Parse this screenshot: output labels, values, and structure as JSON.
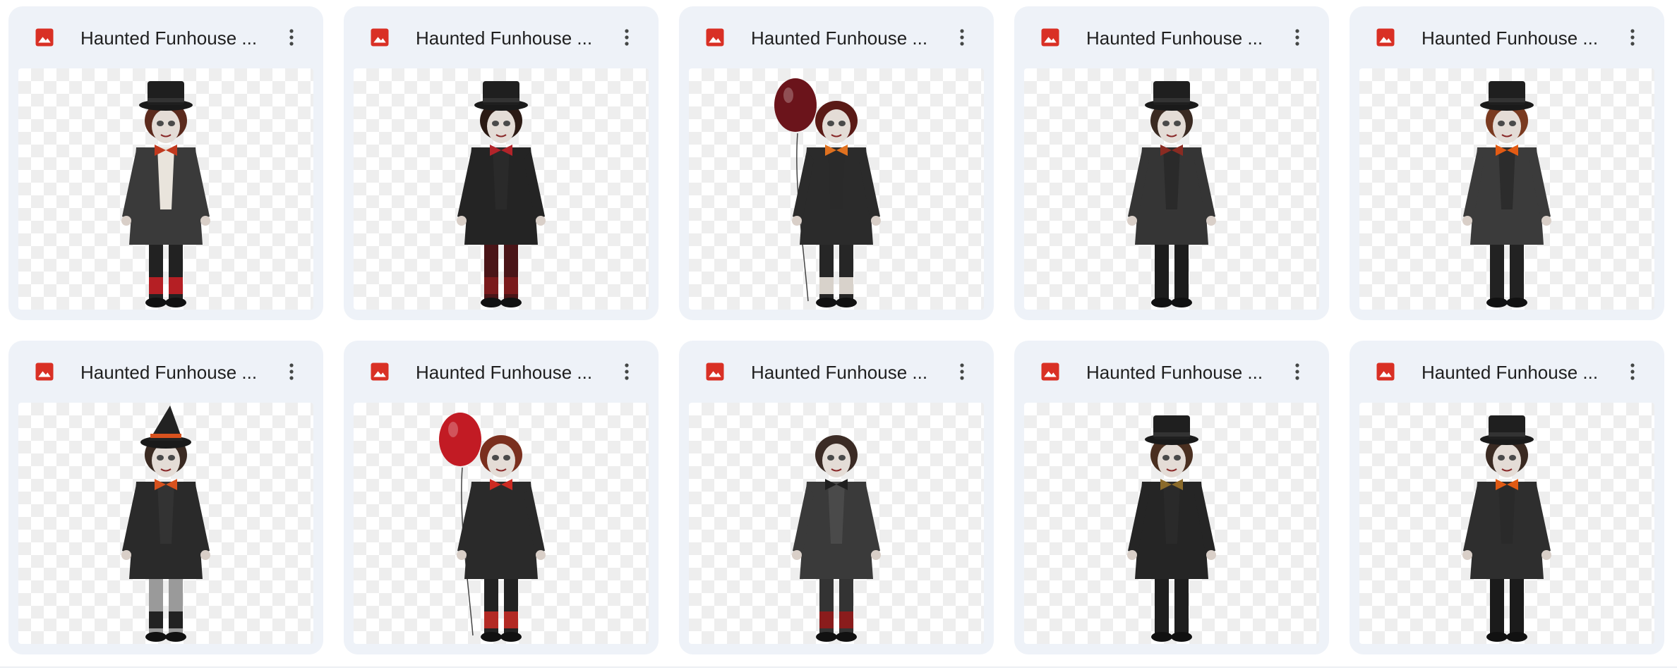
{
  "files": [
    {
      "name": "Haunted Funhouse ...",
      "figure": {
        "hat": "top",
        "hair": "#5b2a1d",
        "tie": "#c0391e",
        "shirt": "#e9e4dc",
        "coat": "#3a3a3a",
        "pants": "#222222",
        "socks": "#b51f24",
        "balloon": null
      }
    },
    {
      "name": "Haunted Funhouse ...",
      "figure": {
        "hat": "top",
        "hair": "#2b1a14",
        "tie": "#b3242a",
        "shirt": "#2a2a2a",
        "coat": "#242424",
        "pants": "#4a1518",
        "socks": "#7a1a1c",
        "balloon": null
      }
    },
    {
      "name": "Haunted Funhouse ...",
      "figure": {
        "hat": "none",
        "hair": "#5a1a16",
        "tie": "#e0711f",
        "shirt": "#2a2a2a",
        "coat": "#2b2b2b",
        "pants": "#262626",
        "socks": "#d8d2cb",
        "balloon": "#6b141b"
      }
    },
    {
      "name": "Haunted Funhouse ...",
      "figure": {
        "hat": "top",
        "hair": "#3a2a22",
        "tie": "#8a2b22",
        "shirt": "#2a2a2a",
        "coat": "#353535",
        "pants": "#1c1c1c",
        "socks": "#1c1c1c",
        "balloon": null
      }
    },
    {
      "name": "Haunted Funhouse ...",
      "figure": {
        "hat": "top",
        "hair": "#7a3a20",
        "tie": "#e35b14",
        "shirt": "#2c2c2c",
        "coat": "#3b3b3b",
        "pants": "#222222",
        "socks": "#222222",
        "balloon": null
      }
    },
    {
      "name": "Haunted Funhouse ...",
      "figure": {
        "hat": "witch",
        "hair": "#3a2a22",
        "tie": "#d8521e",
        "shirt": "#333333",
        "coat": "#2a2a2a",
        "pants": "#9a9a9a",
        "socks": "#222222",
        "balloon": null
      }
    },
    {
      "name": "Haunted Funhouse ...",
      "figure": {
        "hat": "none",
        "hair": "#7a2f1e",
        "tie": "#cc2a22",
        "shirt": "#2a2a2a",
        "coat": "#2a2a2a",
        "pants": "#222222",
        "socks": "#b32a24",
        "balloon": "#c21b24"
      }
    },
    {
      "name": "Haunted Funhouse ...",
      "figure": {
        "hat": "none",
        "hair": "#3b2b25",
        "tie": "#1f1f1f",
        "shirt": "#4a4a4a",
        "coat": "#3a3a3a",
        "pants": "#333333",
        "socks": "#8a1c1c",
        "balloon": null
      }
    },
    {
      "name": "Haunted Funhouse ...",
      "figure": {
        "hat": "top",
        "hair": "#4a2f20",
        "tie": "#8a6a2a",
        "shirt": "#2a2a2a",
        "coat": "#252525",
        "pants": "#1e1e1e",
        "socks": "#1e1e1e",
        "balloon": null
      }
    },
    {
      "name": "Haunted Funhouse ...",
      "figure": {
        "hat": "top",
        "hair": "#3a2a22",
        "tie": "#e05a14",
        "shirt": "#2a2a2a",
        "coat": "#2e2e2e",
        "pants": "#1b1b1b",
        "socks": "#1b1b1b",
        "balloon": null
      }
    }
  ],
  "colors": {
    "card_bg": "#eef2f8",
    "file_icon_red": "#d93025",
    "title_text": "#1f1f1f",
    "icon_gray": "#444746"
  },
  "icons": {
    "file_type": "image-file-icon",
    "menu": "more-vertical-icon"
  }
}
